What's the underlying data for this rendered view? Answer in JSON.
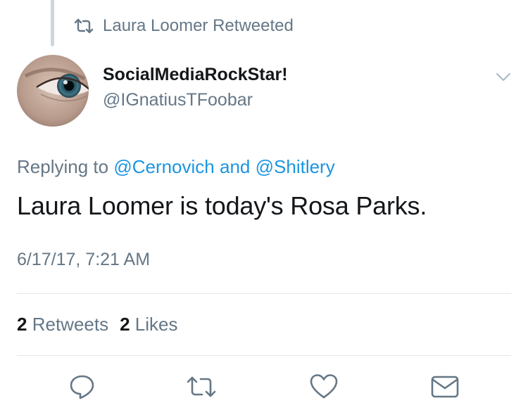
{
  "retweet_header": {
    "icon": "retweet-icon",
    "text": "Laura Loomer Retweeted"
  },
  "author": {
    "avatar": "avatar-eye-closeup",
    "display_name": "SocialMediaRockStar!",
    "handle": "@IGnatiusTFoobar"
  },
  "menu": {
    "icon": "chevron-down-icon"
  },
  "reply_context": {
    "prefix": "Replying to",
    "mention_1": "@Cernovich",
    "conjunction": "and",
    "mention_2": "@Shitlery"
  },
  "tweet": {
    "text": "Laura Loomer is today's Rosa Parks.",
    "timestamp": "6/17/17, 7:21 AM"
  },
  "stats": {
    "retweets_count": "2",
    "retweets_label": "Retweets",
    "likes_count": "2",
    "likes_label": "Likes"
  },
  "actions": [
    {
      "icon": "reply-icon"
    },
    {
      "icon": "retweet-icon"
    },
    {
      "icon": "like-heart-icon"
    },
    {
      "icon": "direct-message-icon"
    }
  ],
  "colors": {
    "text_primary": "#14171a",
    "text_secondary": "#657786",
    "link": "#1b95e0",
    "divider": "#e1e8ed",
    "thread_line": "#ccd6dd"
  }
}
